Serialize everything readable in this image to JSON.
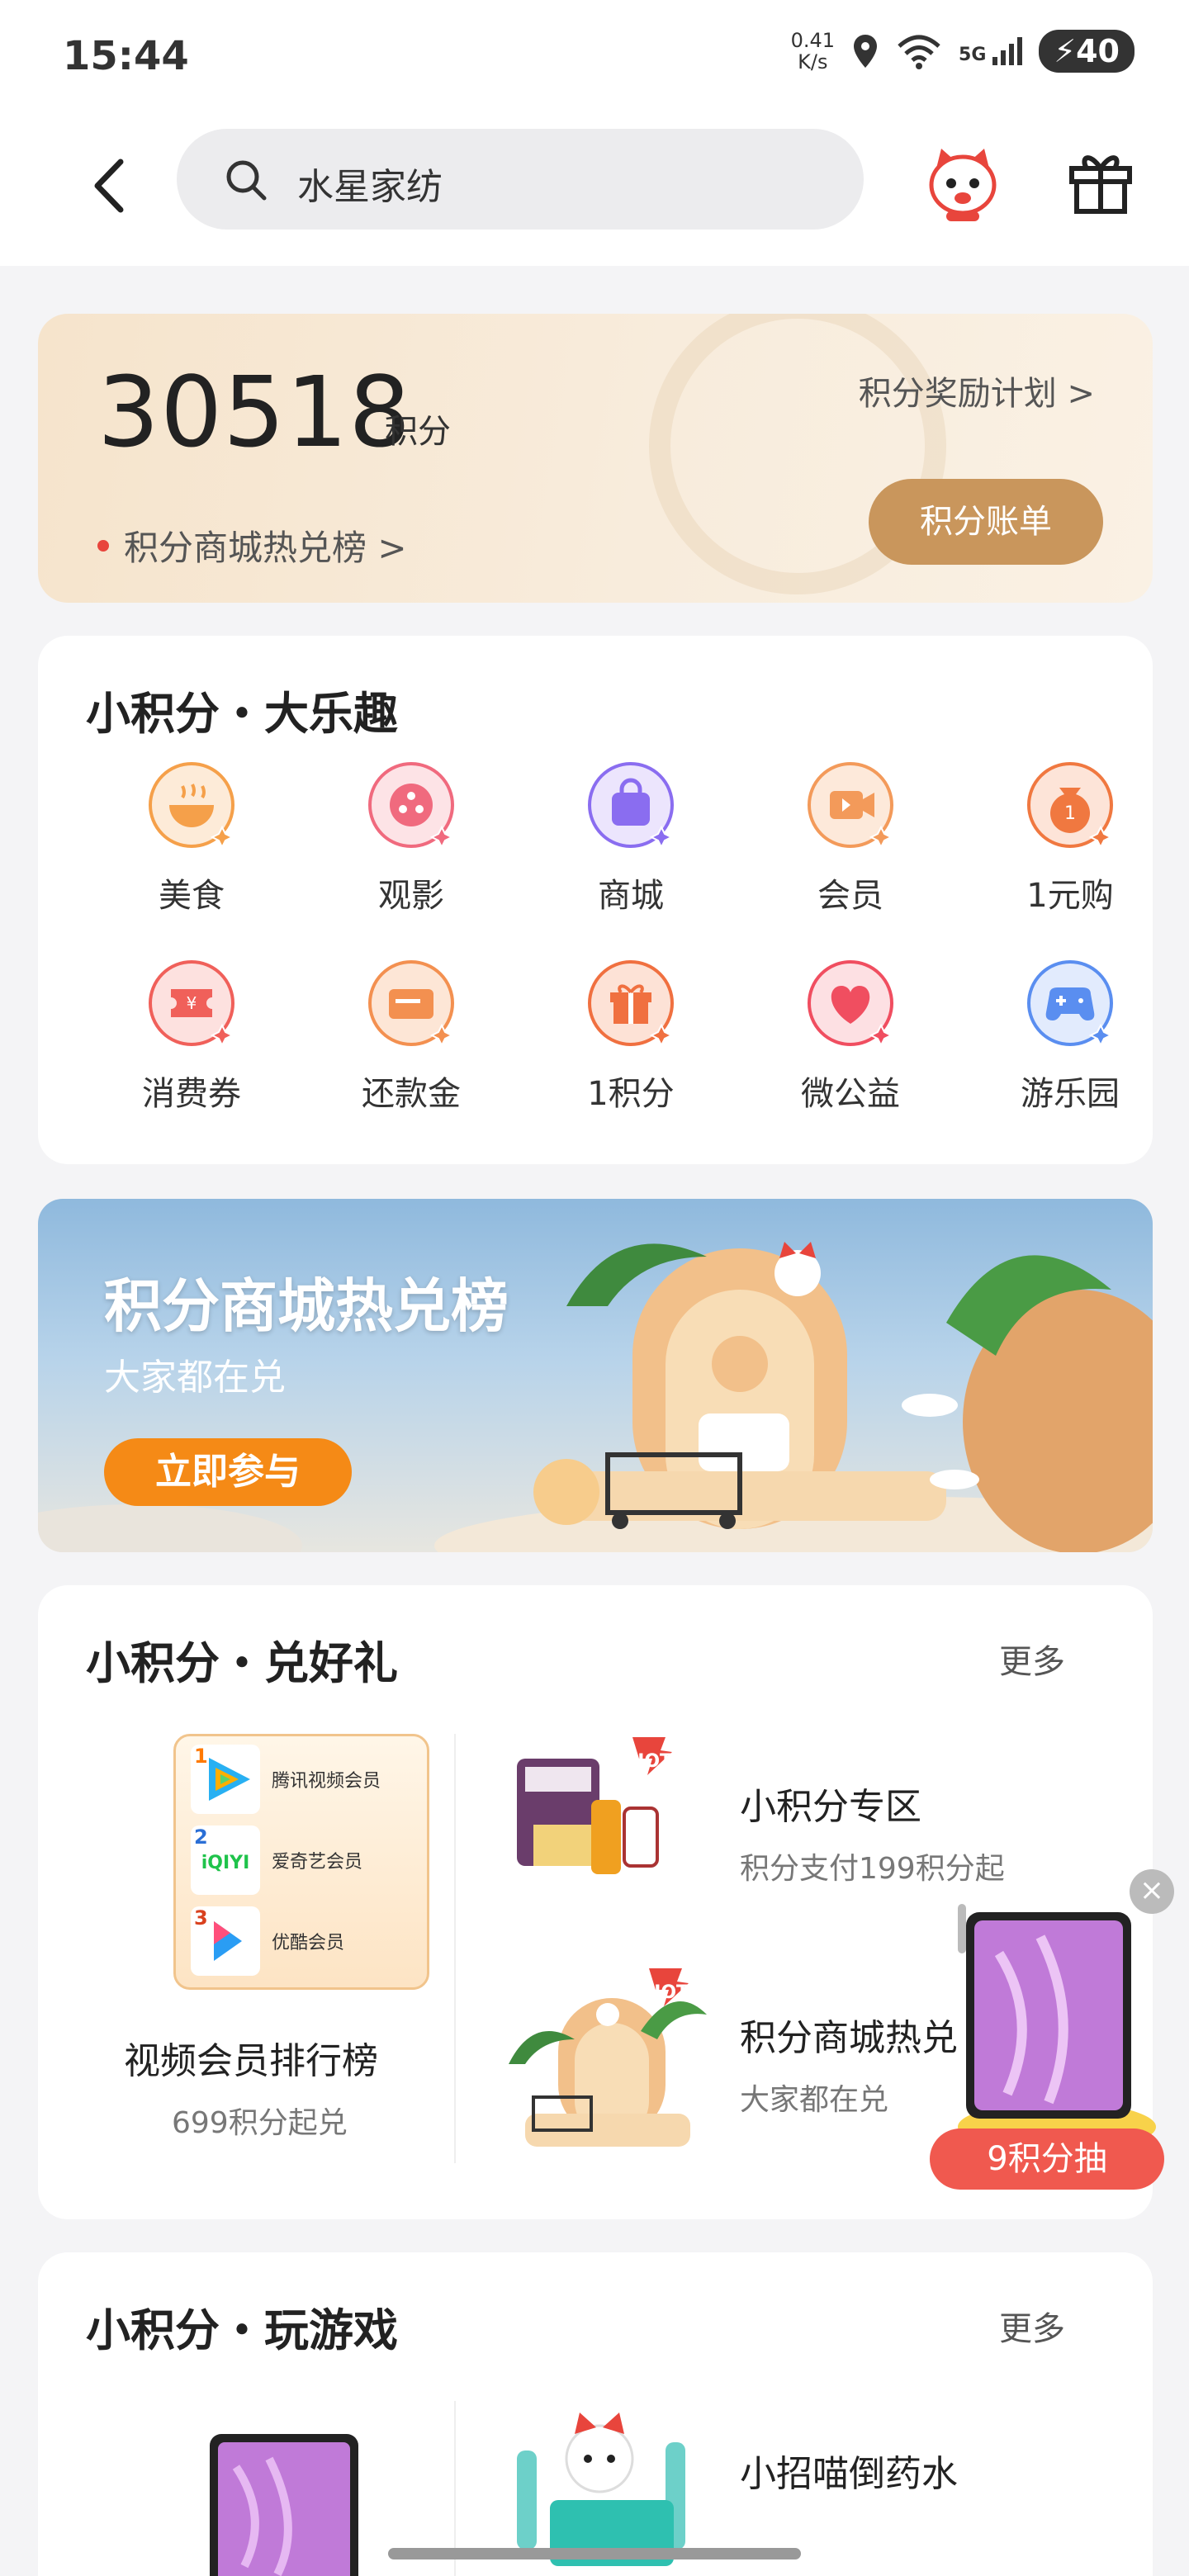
{
  "status_bar": {
    "time": "15:44",
    "speed_value": "0.41",
    "speed_unit": "K/s",
    "network": "5G",
    "battery": "40"
  },
  "header": {
    "search_text": "水星家纺"
  },
  "points": {
    "value": "30518",
    "unit": "积分",
    "reward_plan": "积分奖励计划 >",
    "hot_rank_link": "积分商城热兑榜 >",
    "ledger_button": "积分账单"
  },
  "fun_section": {
    "title": "小积分・大乐趣",
    "items": [
      {
        "label": "美食",
        "icon": "food-bowl-icon",
        "color": "#f5a04a"
      },
      {
        "label": "观影",
        "icon": "film-reel-icon",
        "color": "#f06a7e"
      },
      {
        "label": "商城",
        "icon": "shopping-bag-icon",
        "color": "#8a6df0"
      },
      {
        "label": "会员",
        "icon": "video-member-icon",
        "color": "#f39a5a"
      },
      {
        "label": "1元购",
        "icon": "money-bag-icon",
        "color": "#f07840"
      },
      {
        "label": "消费券",
        "icon": "coupon-icon",
        "color": "#f0605a"
      },
      {
        "label": "还款金",
        "icon": "card-icon",
        "color": "#f39050"
      },
      {
        "label": "1积分",
        "icon": "gift-box-icon",
        "color": "#f07040"
      },
      {
        "label": "微公益",
        "icon": "heart-icon",
        "color": "#f04e60"
      },
      {
        "label": "游乐园",
        "icon": "gamepad-icon",
        "color": "#5a8ef0"
      }
    ]
  },
  "banner": {
    "title": "积分商城热兑榜",
    "subtitle": "大家都在兑",
    "button": "立即参与"
  },
  "gifts_section": {
    "title": "小积分・兑好礼",
    "more": "更多",
    "rank_list": [
      {
        "num": "1",
        "name": "腾讯视频会员",
        "color": "#ff7a00"
      },
      {
        "num": "2",
        "name": "爱奇艺会员",
        "color": "#2b6fd6"
      },
      {
        "num": "3",
        "name": "优酷会员",
        "color": "#d9411e"
      }
    ],
    "rank_title": "视频会员排行榜",
    "rank_sub": "699积分起兑",
    "items": [
      {
        "title": "小积分专区",
        "sub": "积分支付199积分起",
        "badge": "HOT"
      },
      {
        "title": "积分商城热兑",
        "sub": "大家都在兑",
        "badge": "HOT"
      }
    ]
  },
  "games_section": {
    "title": "小积分・玩游戏",
    "more": "更多",
    "items": [
      {
        "title": "小招喵倒药水"
      }
    ]
  },
  "float_ad": {
    "label": "9积分抽"
  }
}
